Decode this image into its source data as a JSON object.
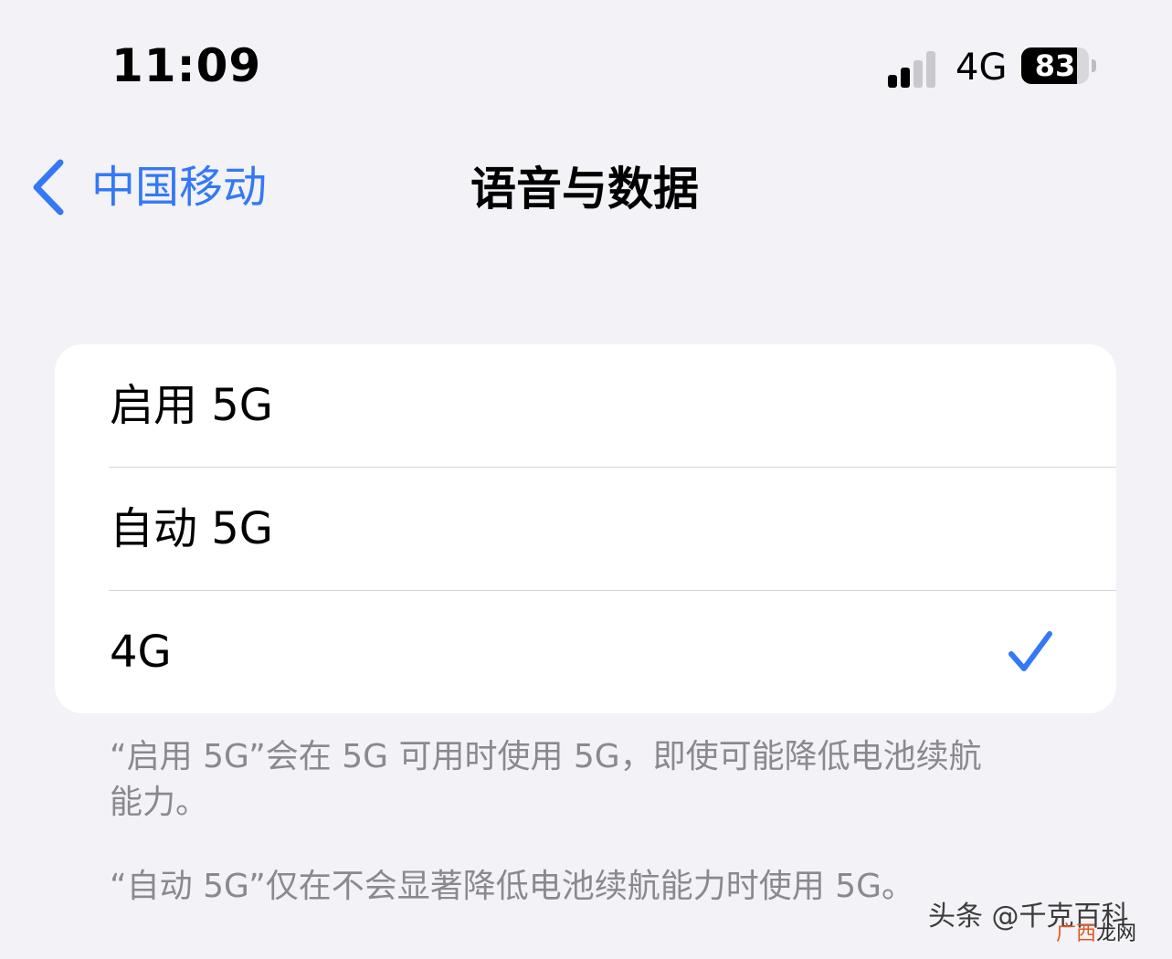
{
  "status_bar": {
    "time": "11:09",
    "network": "4G",
    "battery_level": "83",
    "battery_fraction": 0.83,
    "signal_bars_active": 2,
    "signal_bars_total": 4
  },
  "nav": {
    "back_label": "中国移动",
    "title": "语音与数据"
  },
  "options": [
    {
      "label": "启用 5G",
      "selected": false
    },
    {
      "label": "自动 5G",
      "selected": false
    },
    {
      "label": "4G",
      "selected": true
    }
  ],
  "notes": [
    "“启用 5G”会在 5G 可用时使用 5G，即使可能降低电池续航能力。",
    "“自动 5G”仅在不会显著降低电池续航能力时使用 5G。"
  ],
  "watermark": {
    "text": "头条 @千克百科",
    "site_part1": "广西",
    "site_part2": "龙网"
  },
  "colors": {
    "accent": "#3478f6",
    "background": "#f2f2f7",
    "card": "#ffffff",
    "secondary_text": "#8a8a8e",
    "separator": "#d5d5d9"
  },
  "icons": {
    "back": "chevron-left-icon",
    "selected": "checkmark-icon",
    "signal": "cellular-signal-icon",
    "battery": "battery-icon"
  }
}
